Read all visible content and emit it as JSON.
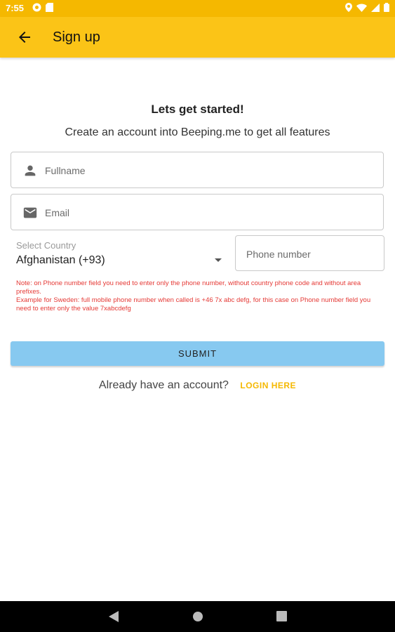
{
  "status_bar": {
    "time": "7:55"
  },
  "app_bar": {
    "title": "Sign up"
  },
  "form": {
    "heading": "Lets get started!",
    "subheading": "Create an account into Beeping.me to get all features",
    "fullname_placeholder": "Fullname",
    "email_placeholder": "Email",
    "country_label": "Select Country",
    "country_value": "Afghanistan (+93)",
    "phone_placeholder": "Phone number",
    "note_line1": "Note: on Phone number field you need to enter only the phone number, without country phone code and without area prefixes.",
    "note_line2": "Example for Sweden: full mobile phone number when called is +46 7x abc defg, for this case on Phone number field you need to enter only the value 7xabcdefg",
    "submit_label": "SUBMIT",
    "login_prompt": "Already have an account?",
    "login_link": "LOGIN HERE"
  },
  "colors": {
    "status_bar": "#f5b800",
    "app_bar": "#fbc417",
    "submit": "#87c9f0",
    "note": "#e53935",
    "link": "#f5b800"
  },
  "icons": {
    "back": "arrow-back-icon",
    "person": "person-icon",
    "email": "mail-icon",
    "dropdown": "caret-down-icon"
  }
}
